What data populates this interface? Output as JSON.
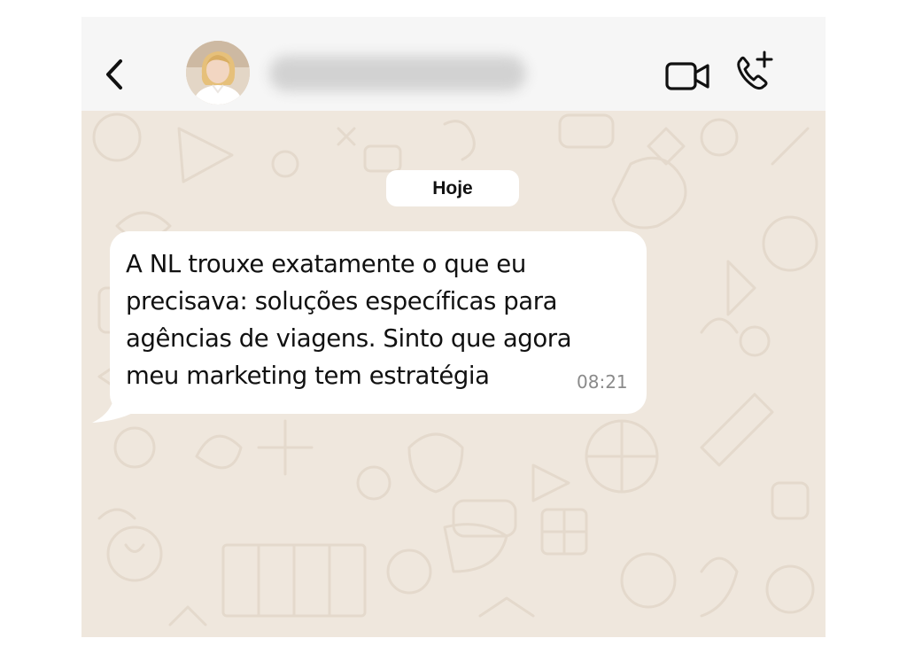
{
  "header": {
    "back_icon": "chevron-left-icon",
    "contact_name": "",
    "video_icon": "video-camera-icon",
    "call_icon": "phone-add-icon"
  },
  "chat": {
    "date_label": "Hoje",
    "messages": [
      {
        "text": "A NL trouxe exatamente o que eu\nprecisava: soluções específicas para\nagências de viagens. Sinto que agora\nmeu marketing tem estratégia",
        "time": "08:21",
        "direction": "incoming"
      }
    ]
  },
  "colors": {
    "header_bg": "#f6f6f6",
    "chat_bg": "#efe7dd",
    "bubble_bg": "#ffffff",
    "time_text": "#8a8a8a",
    "icon": "#111111"
  }
}
